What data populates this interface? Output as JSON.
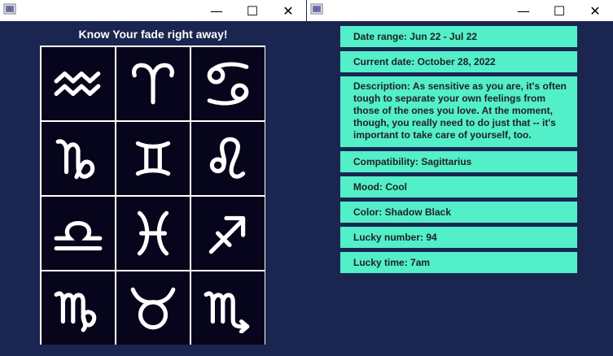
{
  "left_window": {
    "heading": "Know Your fade right away!",
    "signs": [
      {
        "name": "aquarius"
      },
      {
        "name": "aries"
      },
      {
        "name": "cancer"
      },
      {
        "name": "capricorn"
      },
      {
        "name": "gemini"
      },
      {
        "name": "leo"
      },
      {
        "name": "libra"
      },
      {
        "name": "pisces"
      },
      {
        "name": "sagittarius"
      },
      {
        "name": "virgo"
      },
      {
        "name": "taurus"
      },
      {
        "name": "scorpio"
      }
    ]
  },
  "right_window": {
    "date_range": "Date range: Jun 22 - Jul 22",
    "current_date": "Current date: October 28, 2022",
    "description": "Description: As sensitive as you are, it's often tough to separate your own feelings from those of the ones you love. At the moment, though, you really need to do just that -- it's important to take care of yourself, too.",
    "compatibility": "Compatibility: Sagittarius",
    "mood": "Mood: Cool",
    "color": "Color: Shadow Black",
    "lucky_number": "Lucky number: 94",
    "lucky_time": "Lucky time: 7am"
  },
  "titlebar_buttons": {
    "minimize": "—",
    "maximize": "☐",
    "close": "✕"
  },
  "colors": {
    "background": "#1a2650",
    "tile": "#07051c",
    "info_panel": "#52efc9",
    "panel_text": "#222222"
  }
}
